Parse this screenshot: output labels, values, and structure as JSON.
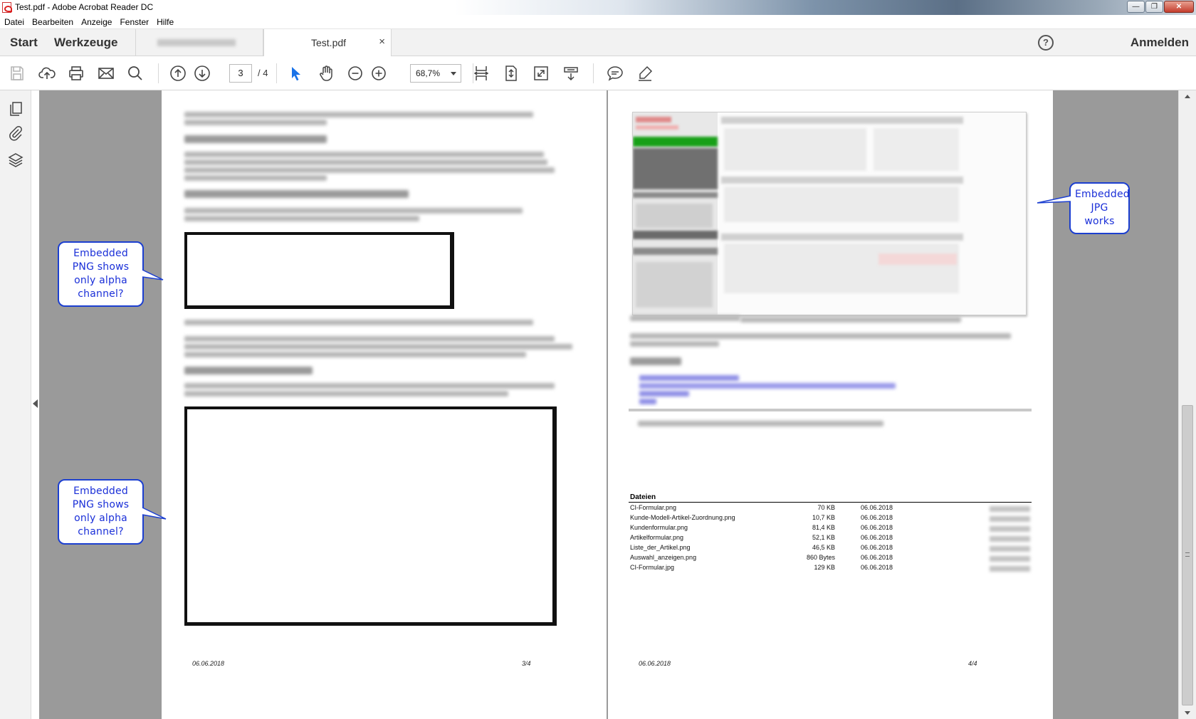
{
  "window": {
    "title": "Test.pdf - Adobe Acrobat Reader DC",
    "controls": [
      "minimize",
      "restore",
      "close"
    ]
  },
  "menu": [
    "Datei",
    "Bearbeiten",
    "Anzeige",
    "Fenster",
    "Hilfe"
  ],
  "tabs": {
    "start": "Start",
    "tools": "Werkzeuge",
    "documents": [
      {
        "label": "",
        "blurred": true,
        "active": false
      },
      {
        "label": "Test.pdf",
        "active": true,
        "close": "×"
      }
    ],
    "help": "?",
    "signin": "Anmelden"
  },
  "toolbar": {
    "icons": [
      "save-icon",
      "upload-icon",
      "print-icon",
      "email-icon",
      "search-icon",
      "previous-page-icon",
      "next-page-icon",
      "select-cursor-icon",
      "hand-icon",
      "zoom-out-icon",
      "zoom-in-icon",
      "fit-width-icon",
      "fit-page-icon",
      "fullscreen-icon",
      "scroll-mode-icon",
      "comment-icon",
      "highlight-pen-icon"
    ],
    "current_page": "3",
    "total_pages": "/ 4",
    "zoom": "68,7%",
    "accent_color": "#1a73e8"
  },
  "left_rail": {
    "icons": [
      "pages-icon",
      "attachments-icon",
      "layers-icon"
    ]
  },
  "pages": [
    {
      "number": 3,
      "footer_date": "06.06.2018",
      "footer_page": "3/4"
    },
    {
      "number": 4,
      "footer_date": "06.06.2018",
      "footer_page": "4/4",
      "files_table": {
        "title": "Dateien",
        "rows": [
          {
            "name": "CI-Formular.png",
            "size": "70 KB",
            "date": "06.06.2018"
          },
          {
            "name": "Kunde-Modell-Artikel-Zuordnung.png",
            "size": "10,7 KB",
            "date": "06.06.2018"
          },
          {
            "name": "Kundenformular.png",
            "size": "81,4 KB",
            "date": "06.06.2018"
          },
          {
            "name": "Artikelformular.png",
            "size": "52,1 KB",
            "date": "06.06.2018"
          },
          {
            "name": "Liste_der_Artikel.png",
            "size": "46,5 KB",
            "date": "06.06.2018"
          },
          {
            "name": "Auswahl_anzeigen.png",
            "size": "860 Bytes",
            "date": "06.06.2018"
          },
          {
            "name": "CI-Formular.jpg",
            "size": "129 KB",
            "date": "06.06.2018"
          }
        ]
      }
    }
  ],
  "annotations": [
    {
      "text": "Embedded PNG shows only alpha channel?",
      "color": "#1a2fd8"
    },
    {
      "text": "Embedded PNG shows only alpha channel?",
      "color": "#1a2fd8"
    },
    {
      "text": "Embedded JPG works",
      "color": "#1a2fd8"
    }
  ]
}
